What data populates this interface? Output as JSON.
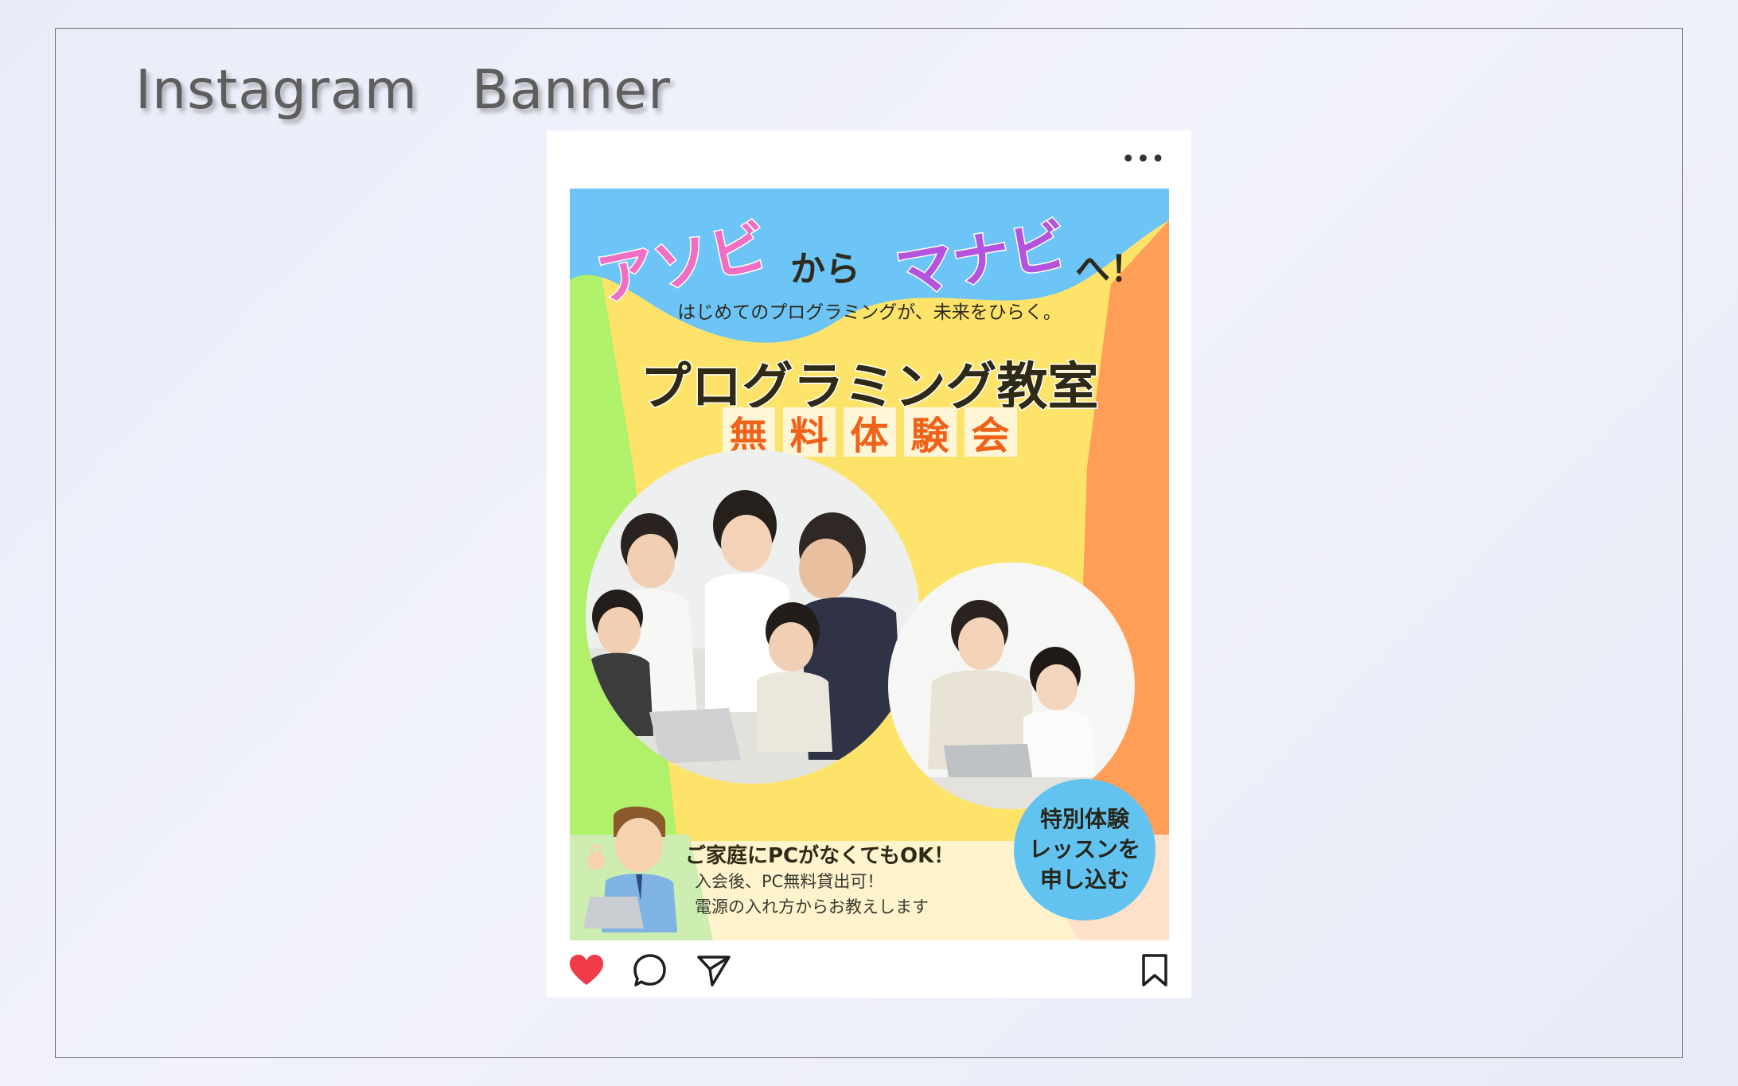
{
  "page": {
    "heading": "Instagram   Banner"
  },
  "post": {
    "more_label": "•••",
    "banner": {
      "catch": {
        "asobi": "アソビ",
        "kara": "から",
        "manabi": "マナビ",
        "he": "へ！"
      },
      "tagline": "はじめてのプログラミングが、未来をひらく。",
      "title": "プログラミング教室",
      "subtitle_chars": [
        "無",
        "料",
        "体",
        "験",
        "会"
      ],
      "badge_lines": [
        "特別体験",
        "レッスンを",
        "申し込む"
      ],
      "note": {
        "headline": "ご家庭にPCがなくてもOK！",
        "line1": "入会後、PC無料貸出可！",
        "line2": "電源の入れ方からお教えします"
      }
    },
    "actions": {
      "like_icon": "heart-icon",
      "comment_icon": "comment-icon",
      "share_icon": "send-icon",
      "save_icon": "bookmark-icon"
    }
  },
  "colors": {
    "sky": "#6dc4f7",
    "green": "#b1f06a",
    "yellow": "#fde36a",
    "orange": "#ff9f57",
    "cream": "#fff3cd",
    "pink": "#ef6fc5",
    "purple": "#b453dd",
    "accent": "#f0611a",
    "heart": "#ef3b4a"
  }
}
